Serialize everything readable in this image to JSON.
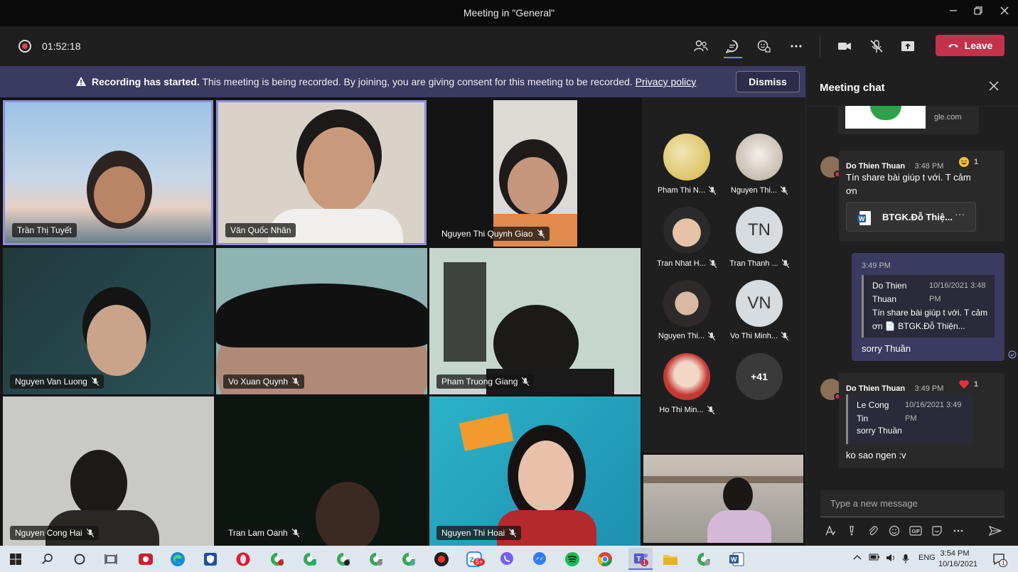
{
  "window": {
    "title": "Meeting in \"General\"",
    "minimize_icon": "minimize-icon",
    "maximize_icon": "restore-icon",
    "close_icon": "close-icon"
  },
  "toolbar": {
    "timer": "01:52:18",
    "leave_label": "Leave",
    "accent": "#c4314b"
  },
  "banner": {
    "title": "Recording has started.",
    "text": "This meeting is being recorded. By joining, you are giving consent for this meeting to be recorded.",
    "link": "Privacy policy",
    "dismiss": "Dismiss"
  },
  "tiles": [
    {
      "name": "Trần Thị Tuyết",
      "muted": false
    },
    {
      "name": "Văn Quốc Nhân",
      "muted": false
    },
    {
      "name": "Nguyen Thi Quynh Giao",
      "muted": true
    },
    {
      "name": "Nguyen Van Luong",
      "muted": true
    },
    {
      "name": "Vo Xuan Quynh",
      "muted": true
    },
    {
      "name": "Pham Truong Giang",
      "muted": true
    },
    {
      "name": "Nguyen Cong Hai",
      "muted": true
    },
    {
      "name": "Tran Lam Oanh",
      "muted": true
    },
    {
      "name": "Nguyen Thi Hoai",
      "muted": true
    },
    {
      "name": "",
      "muted": false
    }
  ],
  "roster": [
    {
      "name": "Pham Thi N...",
      "initials": ""
    },
    {
      "name": "Nguyen Thi...",
      "initials": ""
    },
    {
      "name": "Tran Nhat H...",
      "initials": ""
    },
    {
      "name": "Tran Thanh ...",
      "initials": "TN"
    },
    {
      "name": "Nguyen Thi...",
      "initials": ""
    },
    {
      "name": "Vo Thi Minh...",
      "initials": "VN"
    },
    {
      "name": "Ho Thi Min...",
      "initials": ""
    }
  ],
  "roster_more": "+41",
  "chat": {
    "title": "Meeting chat",
    "link_preview_domain": "gle.com",
    "messages": [
      {
        "sender": "Do Thien Thuan",
        "time": "3:48 PM",
        "text": "Tín share bài giúp t với. T cảm ơn",
        "reaction": "1",
        "attachment": "BTGK.Đỗ Thiệ..."
      },
      {
        "time": "3:49 PM",
        "quote_sender": "Do Thien Thuan",
        "quote_time": "10/16/2021 3:48 PM",
        "quote_text": "Tín share bài giúp t với. T cảm ơn 📄 BTGK.Đỗ Thiện...",
        "text": "sorry Thuần"
      },
      {
        "sender": "Do Thien Thuan",
        "time": "3:49 PM",
        "reaction": "1",
        "quote_sender": "Le Cong Tin",
        "quote_time": "10/16/2021 3:49 PM",
        "quote_text": "sorry Thuần",
        "text": "ko sao ngen :v"
      }
    ],
    "compose_placeholder": "Type a new message"
  },
  "taskbar": {
    "language": "ENG",
    "time": "3:54 PM",
    "date": "10/16/2021",
    "zalo_badge": "5+",
    "teams_badge": "1",
    "notification_badge": "1"
  }
}
